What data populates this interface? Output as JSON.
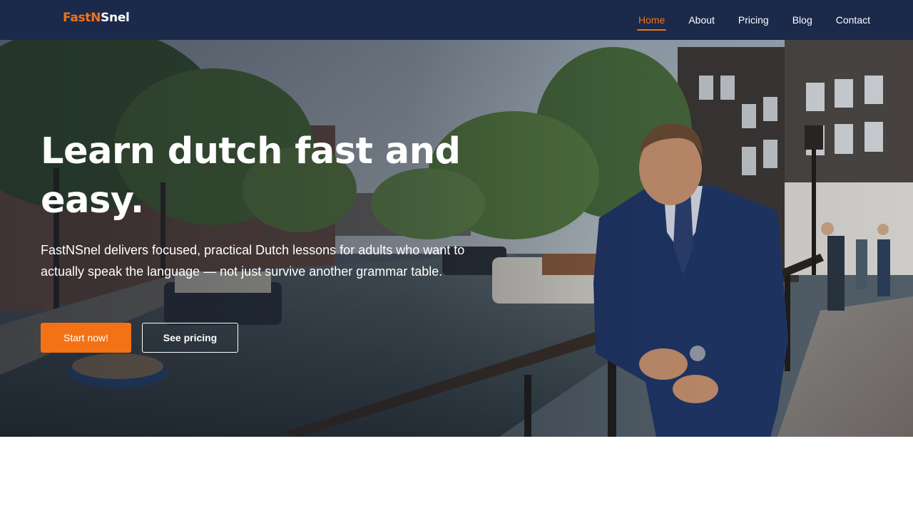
{
  "brand": {
    "part1": "Fast",
    "part2": "N",
    "part3": "Snel",
    "accent_color": "#f47216",
    "nav_bg_color": "#1b2a4a"
  },
  "nav": {
    "items": [
      {
        "label": "Home",
        "active": true
      },
      {
        "label": "About",
        "active": false
      },
      {
        "label": "Pricing",
        "active": false
      },
      {
        "label": "Blog",
        "active": false
      },
      {
        "label": "Contact",
        "active": false
      }
    ]
  },
  "hero": {
    "title_line1": "Learn dutch fast and",
    "title_line2": "easy.",
    "description": "FastNSnel delivers focused, practical Dutch lessons for adults who want to actually speak the language — not just survive another grammar table.",
    "primary_button": "Start now!",
    "secondary_button": "See pricing"
  }
}
